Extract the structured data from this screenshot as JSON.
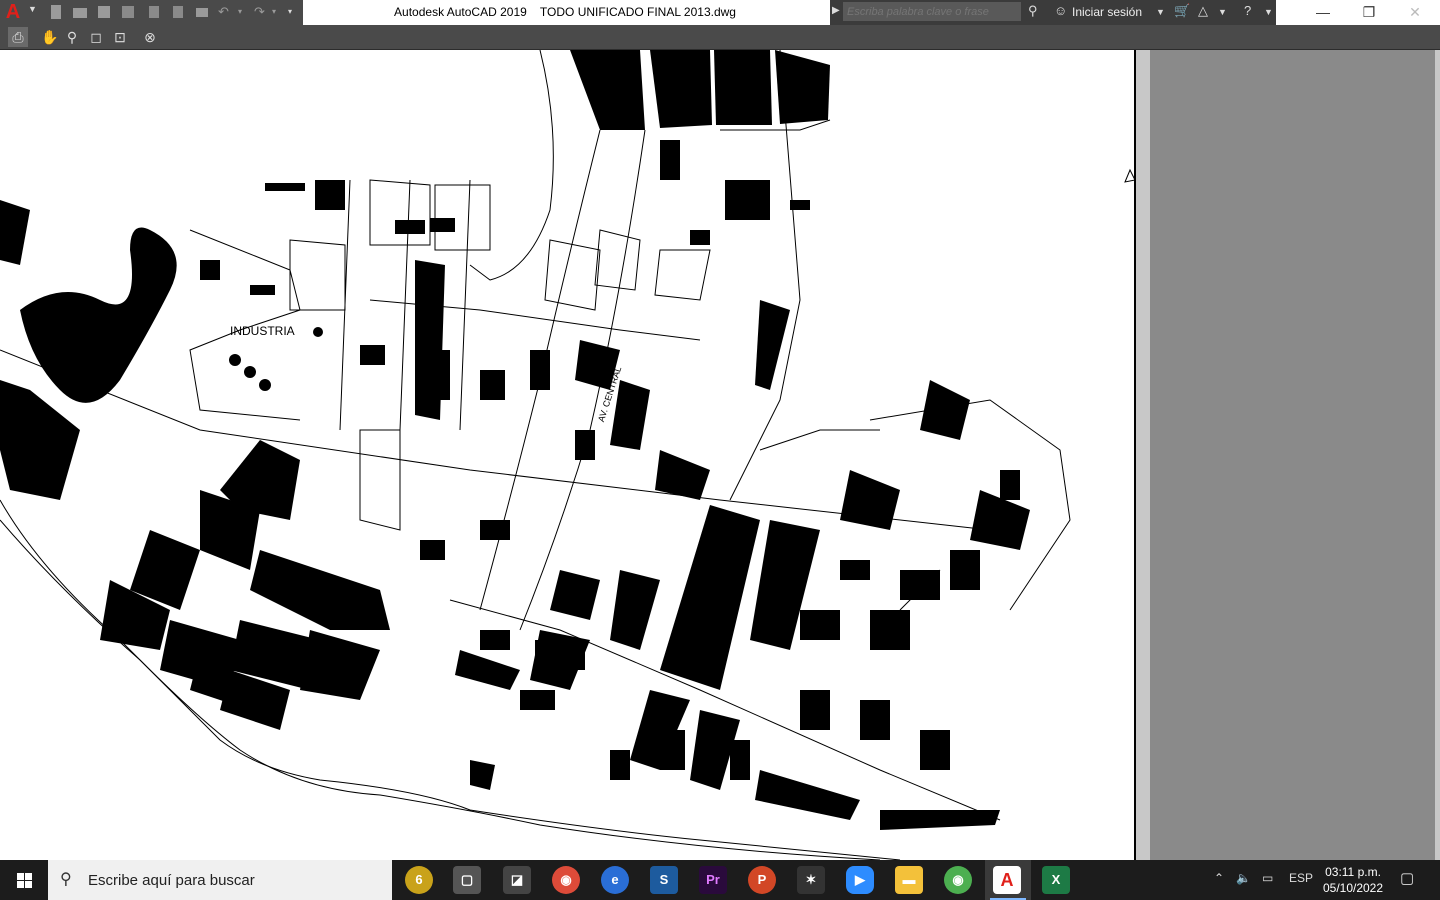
{
  "window": {
    "app_name": "Autodesk AutoCAD 2019",
    "file_name": "TODO UNIFICADO FINAL 2013.dwg",
    "title": "Autodesk AutoCAD 2019    TODO UNIFICADO FINAL 2013.dwg"
  },
  "search": {
    "placeholder": "Escriba palabra clave o frase"
  },
  "account": {
    "signin_label": "Iniciar sesión"
  },
  "drawing": {
    "labels": {
      "industria": "INDUSTRIA",
      "av_central": "AV. CENTRAL"
    }
  },
  "taskbar": {
    "search_placeholder": "Escribe aquí para buscar",
    "apps": [
      "six-icon",
      "app-window-icon",
      "capture-icon",
      "chrome-icon",
      "edge-icon",
      "sketchup-icon",
      "premiere-icon",
      "powerpoint-icon",
      "network-tool-icon",
      "zoom-icon",
      "file-explorer-icon",
      "chrome-profile-icon",
      "autocad-icon",
      "excel-icon"
    ],
    "premiere_label": "Pr",
    "excel_label": "X",
    "autocad_label": "A",
    "language": "ESP",
    "time": "03:11 p.m.",
    "date": "05/10/2022"
  },
  "colors": {
    "toolbar_bg": "#4a4a4a",
    "autocad_red": "#e0201a",
    "taskbar_bg": "#1c1c1c",
    "side_panel": "#8a8a8a"
  }
}
